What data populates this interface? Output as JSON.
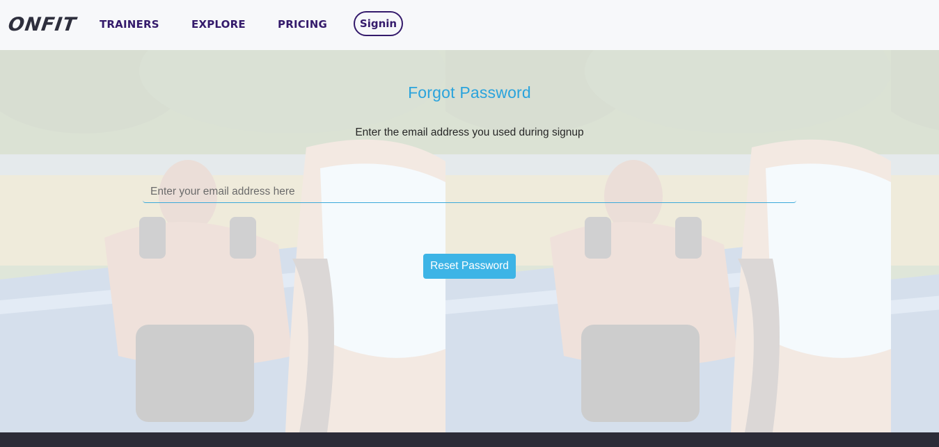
{
  "navbar": {
    "logo": "ONFIT",
    "links": [
      {
        "label": "TRAINERS"
      },
      {
        "label": "EXPLORE"
      },
      {
        "label": "PRICING"
      }
    ],
    "signin_label": "Signin"
  },
  "form": {
    "title": "Forgot Password",
    "subtitle": "Enter the email address you used during signup",
    "email": {
      "value": "",
      "placeholder": "Enter your email address here"
    },
    "reset_label": "Reset Password"
  },
  "colors": {
    "brand": "#341a6b",
    "accent": "#3db4e6",
    "title": "#2aa3dc",
    "footer": "#2c2c38"
  }
}
